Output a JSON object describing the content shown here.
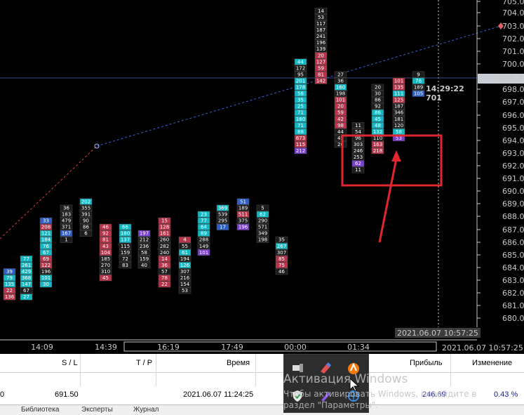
{
  "price_axis": {
    "labels": [
      "705.0",
      "704.0",
      "703.0",
      "702.0",
      "701.0",
      "700.0",
      "698.0",
      "697.0",
      "696.0",
      "695.0",
      "694.0",
      "693.0",
      "692.0",
      "691.0",
      "690.0",
      "689.0",
      "688.0",
      "687.0",
      "686.0",
      "685.0",
      "684.0",
      "683.0",
      "682.0",
      "681.0",
      "680.0"
    ],
    "current_price": "699.2",
    "colors": {
      "current_tag_bg": "#c9ced6",
      "current_tag_text": "#000000"
    }
  },
  "time_axis": {
    "labels": [
      "14:09",
      "14:39",
      "16:19",
      "17:49",
      "00:00",
      "01:34"
    ],
    "cursor_time": "2021.06.07 10:57:25",
    "cursor_time_right": "2021.06.07 10:57:25"
  },
  "crosshair": {
    "time": "14:29:22",
    "price": "701"
  },
  "colors": {
    "cyan": "#12b8c4",
    "red": "#b8344a",
    "blue": "#2f5fc4",
    "purple": "#7a3fd0",
    "dark_cell": "#1c1c1c",
    "green_text": "#b8e08a",
    "annotation": "#e0262e",
    "trend_blue": "#3a5fd6",
    "trend_red": "#d23a3a"
  },
  "clusters": [
    {
      "pmax": 684.0,
      "values": [
        "39",
        "79",
        "135",
        "22",
        "136"
      ],
      "colors": [
        "blue",
        "cyan",
        "cyan",
        "red",
        "red"
      ]
    },
    {
      "pmax": 685.0,
      "values": [
        "77",
        "261",
        "429",
        "368",
        "147",
        "67",
        "27"
      ],
      "colors": [
        "cyan",
        "cyan",
        "cyan",
        "cyan",
        "cyan",
        "dark",
        "cyan"
      ]
    },
    {
      "pmax": 688.0,
      "values": [
        "33",
        "208",
        "121",
        "184",
        "76",
        "67",
        "69",
        "122",
        "196",
        "101",
        "30"
      ],
      "colors": [
        "blue",
        "red",
        "cyan",
        "cyan",
        "cyan",
        "cyan",
        "red",
        "red",
        "dark",
        "cyan",
        "cyan"
      ]
    },
    {
      "pmax": 689.0,
      "values": [
        "36",
        "183",
        "479",
        "371",
        "167",
        "1"
      ],
      "colors": [
        "dark",
        "dark",
        "dark",
        "dark",
        "blue",
        "dark"
      ]
    },
    {
      "pmax": 689.5,
      "values": [
        "202",
        "355",
        "391",
        "90",
        "86",
        "6"
      ],
      "colors": [
        "cyan",
        "dark",
        "dark",
        "dark",
        "dark",
        "dark"
      ]
    },
    {
      "pmax": 687.5,
      "values": [
        "46",
        "92",
        "81",
        "43",
        "104",
        "185",
        "270",
        "310",
        "45"
      ],
      "colors": [
        "red",
        "red",
        "red",
        "red",
        "red",
        "dark",
        "dark",
        "dark",
        "red"
      ]
    },
    {
      "pmax": 687.5,
      "values": [
        "66",
        "180",
        "137",
        "115",
        "159",
        "72",
        "83"
      ],
      "colors": [
        "cyan",
        "cyan",
        "cyan",
        "dark",
        "dark",
        "dark",
        "dark"
      ]
    },
    {
      "pmax": 687.0,
      "values": [
        "197",
        "212",
        "236",
        "58",
        "159",
        "40"
      ],
      "colors": [
        "purple",
        "dark",
        "dark",
        "dark",
        "dark",
        "dark"
      ]
    },
    {
      "pmax": 688.0,
      "values": [
        "15",
        "128",
        "161",
        "260",
        "282",
        "240",
        "14",
        "36",
        "57",
        "78",
        "22"
      ],
      "colors": [
        "red",
        "red",
        "red",
        "dark",
        "dark",
        "dark",
        "red",
        "red",
        "dark",
        "red",
        "red"
      ]
    },
    {
      "pmax": 686.5,
      "values": [
        "4",
        "55",
        "61",
        "194",
        "126",
        "307",
        "216",
        "154",
        "53"
      ],
      "colors": [
        "red",
        "dark",
        "cyan",
        "dark",
        "cyan",
        "dark",
        "dark",
        "dark",
        "dark"
      ]
    },
    {
      "pmax": 688.5,
      "values": [
        "23",
        "77",
        "64",
        "89",
        "288",
        "149",
        "101"
      ],
      "colors": [
        "cyan",
        "cyan",
        "cyan",
        "cyan",
        "dark",
        "dark",
        "purple"
      ]
    },
    {
      "pmax": 689.0,
      "values": [
        "369",
        "539",
        "295",
        "17"
      ],
      "colors": [
        "cyan",
        "dark",
        "dark",
        "blue"
      ]
    },
    {
      "pmax": 689.5,
      "values": [
        "51",
        "189",
        "511",
        "375",
        "196"
      ],
      "colors": [
        "blue",
        "dark",
        "red",
        "dark",
        "purple"
      ]
    },
    {
      "pmax": 689.0,
      "values": [
        "5",
        "62",
        "290",
        "571",
        "349",
        "198"
      ],
      "colors": [
        "dark",
        "cyan",
        "dark",
        "dark",
        "dark",
        "dark"
      ]
    },
    {
      "pmax": 686.5,
      "values": [
        "35",
        "267",
        "307",
        "85",
        "75",
        "46"
      ],
      "colors": [
        "dark",
        "cyan",
        "dark",
        "red",
        "red",
        "dark"
      ]
    },
    {
      "pmax": 700.5,
      "values": [
        "44",
        "172",
        "95",
        "201",
        "178",
        "58",
        "35",
        "25",
        "71",
        "180",
        "71",
        "88",
        "673",
        "115",
        "212"
      ],
      "colors": [
        "cyan",
        "dark",
        "dark",
        "cyan",
        "cyan",
        "cyan",
        "cyan",
        "cyan",
        "cyan",
        "cyan",
        "cyan",
        "cyan",
        "red",
        "red",
        "purple"
      ]
    },
    {
      "pmax": 704.5,
      "values": [
        "14",
        "53",
        "117",
        "187",
        "241",
        "196",
        "139",
        "20",
        "127",
        "59",
        "81",
        "142"
      ],
      "colors": [
        "dark",
        "dark",
        "dark",
        "dark",
        "dark",
        "dark",
        "dark",
        "red",
        "red",
        "red",
        "red",
        "red"
      ]
    },
    {
      "pmax": 699.5,
      "values": [
        "27",
        "36",
        "160",
        "198",
        "101",
        "20",
        "59",
        "42",
        "98",
        "44",
        "45",
        "20"
      ],
      "colors": [
        "dark",
        "dark",
        "cyan",
        "dark",
        "red",
        "red",
        "red",
        "red",
        "red",
        "dark",
        "dark",
        "dark"
      ]
    },
    {
      "pmax": 695.5,
      "values": [
        "11",
        "54",
        "96",
        "303",
        "246",
        "253",
        "62",
        "11"
      ],
      "colors": [
        "dark",
        "dark",
        "dark",
        "dark",
        "dark",
        "dark",
        "purple",
        "dark"
      ]
    },
    {
      "pmax": 698.5,
      "values": [
        "20",
        "30",
        "86",
        "92",
        "86",
        "45",
        "48",
        "132",
        "110",
        "163",
        "218"
      ],
      "colors": [
        "dark",
        "dark",
        "dark",
        "dark",
        "cyan",
        "cyan",
        "cyan",
        "cyan",
        "dark",
        "red",
        "red"
      ]
    },
    {
      "pmax": 699.0,
      "values": [
        "101",
        "135",
        "111",
        "125",
        "187",
        "346",
        "181",
        "120",
        "58",
        "53"
      ],
      "colors": [
        "red",
        "red",
        "cyan",
        "red",
        "dark",
        "dark",
        "dark",
        "dark",
        "cyan",
        "purple"
      ]
    },
    {
      "pmax": 699.5,
      "values": [
        "9",
        "76",
        "189",
        "105"
      ],
      "colors": [
        "dark",
        "cyan",
        "dark",
        "blue"
      ]
    }
  ],
  "terminal": {
    "headers": {
      "sl": "S / L",
      "tp": "T / P",
      "time": "Время",
      "profit": "Прибыль",
      "change": "Изменение"
    },
    "row": {
      "price": "0",
      "sl": "691.50",
      "tp": "",
      "time": "2021.06.07 11:24:25",
      "profit": "246.69",
      "change": "0.43 %"
    },
    "tabs": [
      "Библиотека",
      "Эксперты",
      "Журнал"
    ]
  },
  "watermark": {
    "line1": "Активация Windows",
    "line2": "Чтобы активировать Windows, перейдите в",
    "line3": "раздел \"Параметры\"."
  },
  "tray": {
    "icons": [
      "usb-device-icon",
      "color-picker-icon",
      "avast-icon",
      "shield-check-icon",
      "pen-icon",
      "network-icon"
    ]
  }
}
